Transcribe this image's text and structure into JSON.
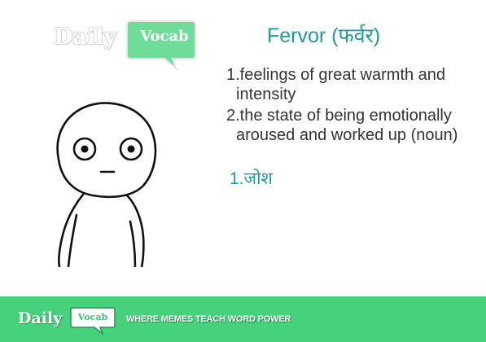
{
  "logo": {
    "daily": "Daily",
    "vocab": "Vocab"
  },
  "word": {
    "title": "Fervor (फर्वर)"
  },
  "definitions": [
    "1.feelings of great warmth and intensity",
    "2.the state of being emotionally aroused and worked up (noun)"
  ],
  "hindi_meaning": "1.जोश",
  "footer": {
    "daily": "Daily",
    "vocab": "Vocab",
    "tagline": "WHERE MEMES TEACH WORD POWER"
  },
  "colors": {
    "accent_teal": "#1f9a9a",
    "footer_green": "#46d27c",
    "bubble_green": "#6fdc9a"
  },
  "icons": {
    "top_logo": "daily-vocab-logo",
    "character": "meme-face-illustration",
    "footer_logo": "daily-vocab-logo"
  }
}
